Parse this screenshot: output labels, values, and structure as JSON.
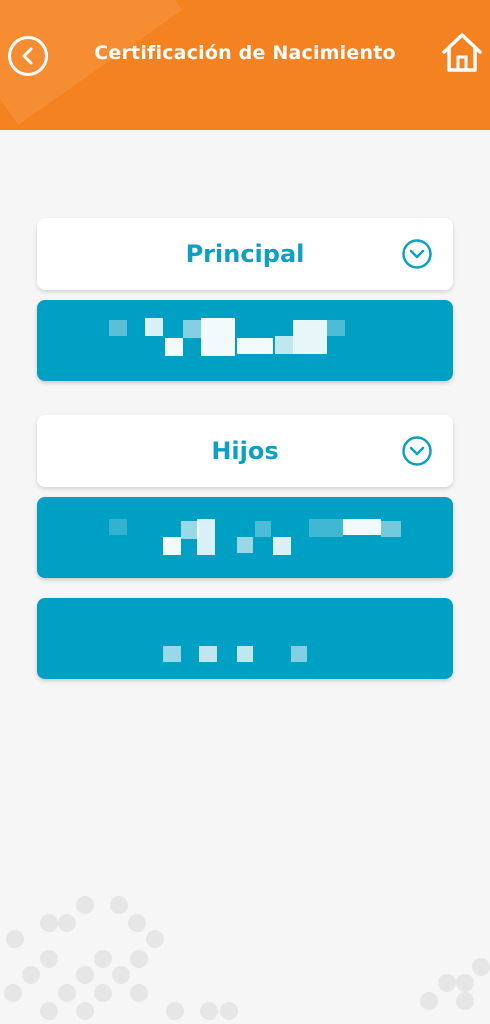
{
  "header": {
    "title": "Certificación de Nacimiento",
    "color": "#f58220"
  },
  "sections": {
    "principal": {
      "label": "Principal"
    },
    "hijos": {
      "label": "Hijos"
    }
  },
  "colors": {
    "accent": "#0e9fc3",
    "card": "#009fc4",
    "background": "#f6f6f6"
  },
  "icons": {
    "back": "chevron-left-circle-icon",
    "home": "home-icon",
    "expand": "chevron-down-circle-icon"
  }
}
